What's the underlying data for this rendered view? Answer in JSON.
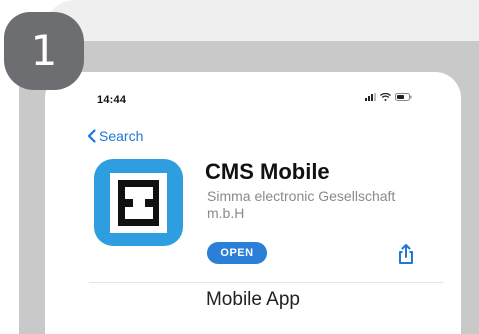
{
  "step": {
    "number": "1"
  },
  "status_bar": {
    "time": "14:44"
  },
  "nav": {
    "back_label": "Search"
  },
  "app": {
    "name": "CMS Mobile",
    "developer": "Simma electronic Gesellschaft m.b.H",
    "open_label": "OPEN",
    "icon_color": "#2e9ee0"
  },
  "caption": "Mobile App",
  "icons": {
    "back": "chevron-left-icon",
    "share": "share-icon",
    "signal": "cellular-signal-icon",
    "wifi": "wifi-icon",
    "battery": "battery-icon"
  },
  "colors": {
    "accent": "#1e78d6",
    "badge": "#6d6e71",
    "frame": "#c9c9c9"
  }
}
